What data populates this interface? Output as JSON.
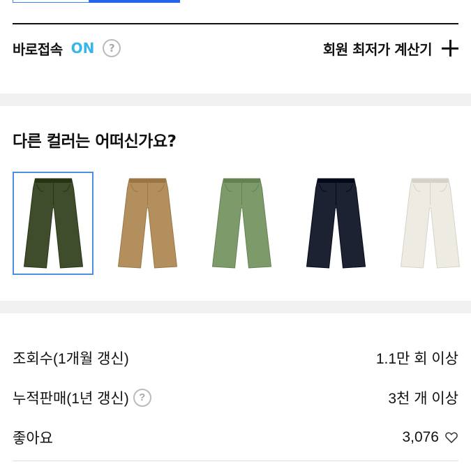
{
  "quick_access": {
    "label": "바로접속",
    "toggle": "ON",
    "help_icon": "question-circle-icon"
  },
  "calculator": {
    "label": "회원 최저가 계산기",
    "icon": "plus-icon"
  },
  "colors": {
    "title": "다른 컬러는 어떠신가요?",
    "items": [
      {
        "name": "olive",
        "color": "#3f4d2d",
        "selected": true
      },
      {
        "name": "khaki",
        "color": "#b38f5e",
        "selected": false
      },
      {
        "name": "sage",
        "color": "#7d9a6a",
        "selected": false
      },
      {
        "name": "navy",
        "color": "#1d2233",
        "selected": false
      },
      {
        "name": "ivory",
        "color": "#eeebe2",
        "selected": false
      }
    ]
  },
  "stats": {
    "views": {
      "label": "조회수(1개월 갱신)",
      "value": "1.1만 회 이상"
    },
    "sales": {
      "label": "누적판매(1년 갱신)",
      "value": "3천 개 이상",
      "help_icon": "question-circle-icon"
    },
    "likes": {
      "label": "좋아요",
      "value": "3,076",
      "icon": "heart-outline-icon"
    }
  }
}
